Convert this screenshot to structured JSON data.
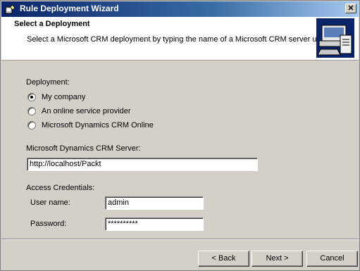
{
  "window": {
    "title": "Rule Deployment Wizard",
    "close_glyph": "✕"
  },
  "header": {
    "title": "Select a Deployment",
    "subtitle": "Select a Microsoft CRM deployment by typing the name of a Microsoft CRM server url.",
    "graphic_icon": "computer-server-icon"
  },
  "deployment": {
    "label": "Deployment:",
    "options": [
      {
        "label": "My company",
        "checked": true
      },
      {
        "label": "An online service provider",
        "checked": false
      },
      {
        "label": "Microsoft Dynamics CRM Online",
        "checked": false
      }
    ]
  },
  "server": {
    "label": "Microsoft Dynamics CRM Server:",
    "value": "http://localhost/Packt"
  },
  "credentials": {
    "label": "Access Credentials:",
    "username_label": "User name:",
    "username_value": "admin",
    "password_label": "Password:",
    "password_value": "**********"
  },
  "buttons": {
    "back": "< Back",
    "next": "Next >",
    "cancel": "Cancel"
  },
  "colors": {
    "titlebar_start": "#0a246a",
    "titlebar_end": "#a6caf0",
    "dialog_bg": "#d4d0c8"
  }
}
